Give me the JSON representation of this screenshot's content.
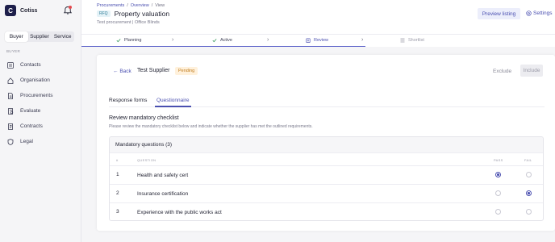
{
  "app": {
    "name": "Cotiss",
    "logo_letter": "C"
  },
  "sidebar": {
    "role_tabs": [
      {
        "label": "Buyer",
        "active": true
      },
      {
        "label": "Supplier",
        "active": false
      },
      {
        "label": "Service",
        "active": false
      }
    ],
    "section_label": "BUYER",
    "items": [
      {
        "label": "Contacts",
        "icon": "contacts-icon"
      },
      {
        "label": "Organisation",
        "icon": "home-icon"
      },
      {
        "label": "Procurements",
        "icon": "document-icon"
      },
      {
        "label": "Evaluate",
        "icon": "evaluate-icon"
      },
      {
        "label": "Contracts",
        "icon": "contract-icon"
      },
      {
        "label": "Legal",
        "icon": "shield-icon"
      }
    ]
  },
  "header": {
    "breadcrumb": [
      "Procurements",
      "Overview",
      "View"
    ],
    "badge": "RFQ",
    "title": "Property valuation",
    "subtitle": "Test procurement | Office Blinds",
    "preview_label": "Preview listing",
    "settings_label": "Settings"
  },
  "stepper": {
    "steps": [
      {
        "label": "Planning",
        "state": "done"
      },
      {
        "label": "Active",
        "state": "done"
      },
      {
        "label": "Review",
        "state": "current"
      },
      {
        "label": "Shortlist",
        "state": "upcoming"
      }
    ]
  },
  "review": {
    "back_label": "Back",
    "supplier_name": "Test Supplier",
    "status": "Pending",
    "exclude_label": "Exclude",
    "include_label": "Include",
    "tabs": [
      {
        "label": "Response forms",
        "active": false
      },
      {
        "label": "Questionnaire",
        "active": true
      }
    ],
    "section_title": "Review mandatory checklist",
    "section_desc": "Please review the mandatory checklist below and indicate whether the supplier has met the outlined requirements.",
    "box_title": "Mandatory questions (3)",
    "columns": {
      "num": "#",
      "question": "QUESTION",
      "pass": "PASS",
      "fail": "FAIL"
    },
    "questions": [
      {
        "num": "1",
        "text": "Health and safety cert",
        "pass": true,
        "fail": false
      },
      {
        "num": "2",
        "text": "Insurance certification",
        "pass": false,
        "fail": true
      },
      {
        "num": "3",
        "text": "Experience with the public works act",
        "pass": false,
        "fail": false
      }
    ]
  },
  "colors": {
    "accent": "#4a4fb0",
    "pending_bg": "#fff1dc",
    "pending_text": "#c07b1c"
  }
}
